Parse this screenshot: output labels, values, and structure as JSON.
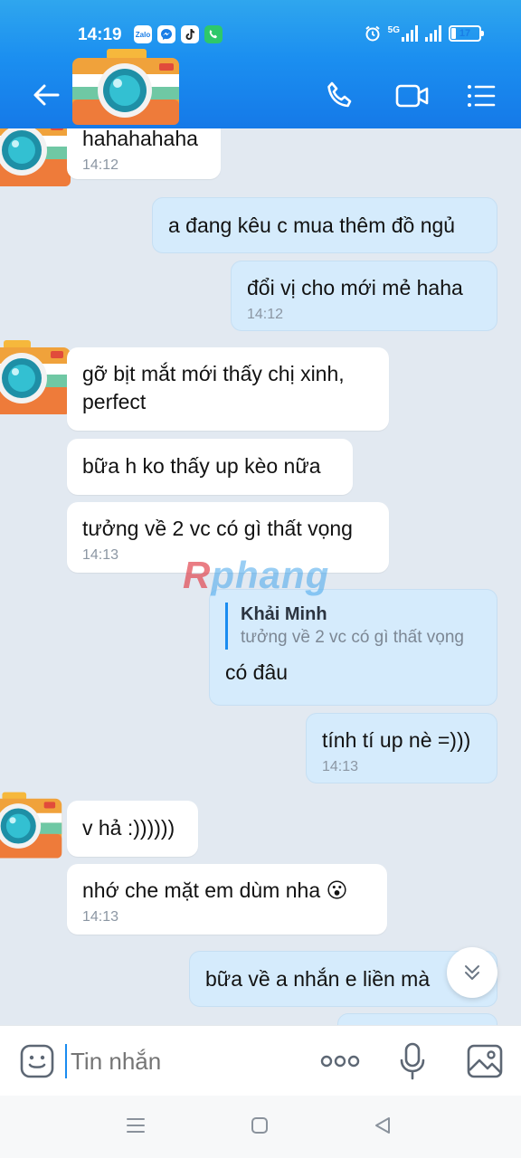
{
  "status_bar": {
    "time": "14:19",
    "app_icons": [
      "Zalo",
      "messenger-icon",
      "tiktok-icon",
      "phone-icon"
    ],
    "network": "5G",
    "battery_level": 17,
    "battery_text": "17"
  },
  "header": {
    "icons": [
      "back-arrow-icon",
      "phone-call-icon",
      "video-call-icon",
      "menu-list-icon"
    ],
    "accent": "#1b8ff0"
  },
  "messages": [
    {
      "side": "in",
      "text": "hahahahaha",
      "time": "14:12"
    },
    {
      "side": "out",
      "text": "a đang kêu c mua thêm đồ ngủ",
      "time": ""
    },
    {
      "side": "out",
      "text": "đổi vị cho mới mẻ haha",
      "time": "14:12"
    },
    {
      "side": "in",
      "text": "gỡ bịt mắt mới thấy chị xinh, perfect",
      "time": ""
    },
    {
      "side": "in",
      "text": "bữa h ko thấy up kèo nữa",
      "time": ""
    },
    {
      "side": "in",
      "text": "tưởng về 2 vc có gì thất vọng",
      "time": "14:13"
    },
    {
      "side": "out",
      "quote_name": "Khải Minh",
      "quote_text": "tưởng về 2 vc có gì thất vọng",
      "text": "có đâu",
      "time": ""
    },
    {
      "side": "out",
      "text": "tính tí up nè =)))",
      "time": "14:13"
    },
    {
      "side": "in",
      "text": "v hả :))))))",
      "time": ""
    },
    {
      "side": "in",
      "text": "nhớ che mặt em dùm nha 😮",
      "time": "14:13"
    },
    {
      "side": "out",
      "text": "bữa về a nhắn e liền mà",
      "time": ""
    }
  ],
  "watermark": {
    "first": "R",
    "rest": "phang"
  },
  "input": {
    "placeholder": "Tin nhắn"
  },
  "colors": {
    "outgoing_bubble": "#d5ebfc",
    "incoming_bubble": "#ffffff",
    "background": "#e2e9f1"
  }
}
